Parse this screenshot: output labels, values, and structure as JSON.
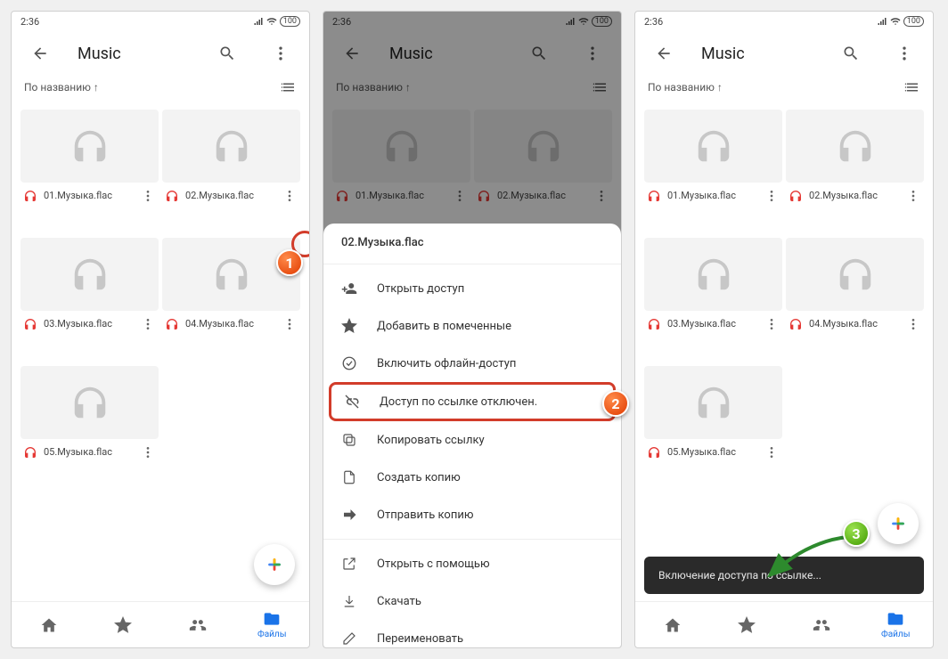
{
  "status": {
    "time": "2:36",
    "battery": "100"
  },
  "header": {
    "title": "Music"
  },
  "sort": {
    "label": "По названию ↑"
  },
  "files": [
    {
      "name": "01.Музыка.flac"
    },
    {
      "name": "02.Музыка.flac"
    },
    {
      "name": "03.Музыка.flac"
    },
    {
      "name": "04.Музыка.flac"
    },
    {
      "name": "05.Музыка.flac"
    }
  ],
  "grid_left_items": [
    0,
    1,
    2,
    3,
    4
  ],
  "grid_right_items": [
    0,
    1,
    2,
    3,
    4
  ],
  "sheet": {
    "file": "02.Музыка.flac",
    "items": {
      "share": "Открыть доступ",
      "star": "Добавить в помеченные",
      "offline": "Включить офлайн-доступ",
      "link_off": "Доступ по ссылке отключен.",
      "copy_link": "Копировать ссылку",
      "copy": "Создать копию",
      "send_copy": "Отправить копию",
      "open_with": "Открыть с помощью",
      "download": "Скачать",
      "rename": "Переименовать"
    }
  },
  "toast": {
    "text": "Включение доступа по ссылке..."
  },
  "nav": {
    "files": "Файлы"
  },
  "callouts": {
    "c1": "1",
    "c2": "2",
    "c3": "3"
  }
}
